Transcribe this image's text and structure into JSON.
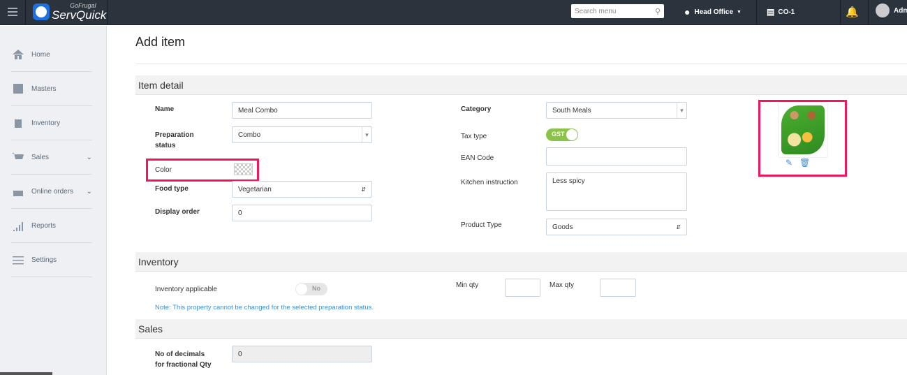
{
  "header": {
    "brand_top": "GoFrugal",
    "brand": "ServQuick",
    "search_placeholder": "Search menu",
    "location": "Head Office",
    "counter": "CO-1",
    "user": "Adm"
  },
  "sidebar": {
    "items": [
      {
        "label": "Home"
      },
      {
        "label": "Masters"
      },
      {
        "label": "Inventory"
      },
      {
        "label": "Sales"
      },
      {
        "label": "Online orders"
      },
      {
        "label": "Reports"
      },
      {
        "label": "Settings"
      }
    ]
  },
  "page": {
    "title": "Add item"
  },
  "item_detail": {
    "title": "Item detail",
    "name_label": "Name",
    "name": "Meal Combo",
    "prep_label": "Preparation status",
    "prep": "Combo",
    "color_label": "Color",
    "food_label": "Food type",
    "food": "Vegetarian",
    "order_label": "Display order",
    "order": "0",
    "category_label": "Category",
    "category": "South Meals",
    "tax_label": "Tax type",
    "tax": "GST",
    "ean_label": "EAN Code",
    "ean": "",
    "kitchen_label": "Kitchen instruction",
    "kitchen": "Less spicy",
    "product_label": "Product Type",
    "product": "Goods"
  },
  "inventory": {
    "title": "Inventory",
    "applicable_label": "Inventory applicable",
    "applicable": "No",
    "min_label": "Min qty",
    "max_label": "Max qty",
    "note": "Note: This property cannot be changed for the selected preparation status."
  },
  "sales": {
    "title": "Sales",
    "decimals_label_1": "No of decimals",
    "decimals_label_2": "for fractional Qty",
    "decimals": "0"
  },
  "colors": {
    "accent": "#3a8fd6",
    "highlight": "#f0185a",
    "toggle_on": "#8bc34a"
  }
}
